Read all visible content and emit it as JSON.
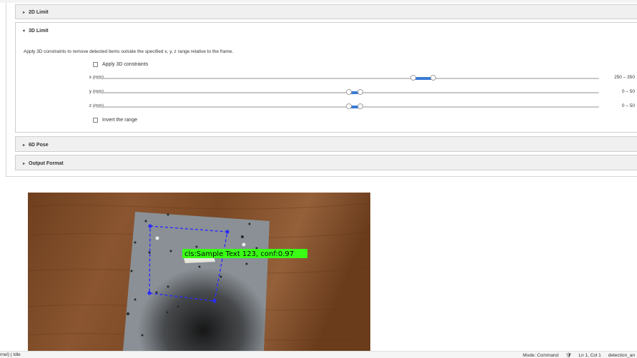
{
  "panels": {
    "limit2d": {
      "title": "2D Limit",
      "expanded": false
    },
    "limit3d": {
      "title": "3D Limit",
      "expanded": true,
      "description": "Apply 3D constraints to remove detected items outside the specified x, y, z range relative to the frame.",
      "apply_label": "Apply 3D constraints",
      "apply_checked": false,
      "invert_label": "Invert the range",
      "invert_checked": false,
      "sliders": [
        {
          "label": "x (mm)",
          "value_text": "250 – 350",
          "low_fraction": 0.63,
          "high_fraction": 0.67
        },
        {
          "label": "y (mm)",
          "value_text": "0 – 50",
          "low_fraction": 0.503,
          "high_fraction": 0.525
        },
        {
          "label": "z (mm)",
          "value_text": "0 – 50",
          "low_fraction": 0.503,
          "high_fraction": 0.525
        }
      ]
    },
    "pose6d": {
      "title": "6D Pose",
      "expanded": false
    },
    "output_format": {
      "title": "Output Format",
      "expanded": false
    }
  },
  "image": {
    "detection_label": "cls:Sample Text 123, conf:0.97",
    "label_color": "#39ff14",
    "box_color": "#2b2bff"
  },
  "statusbar": {
    "kernel": "rnel) | Idle",
    "mode": "Mode: Command",
    "position": "Ln 1, Col 1",
    "filename": "detection_an"
  }
}
